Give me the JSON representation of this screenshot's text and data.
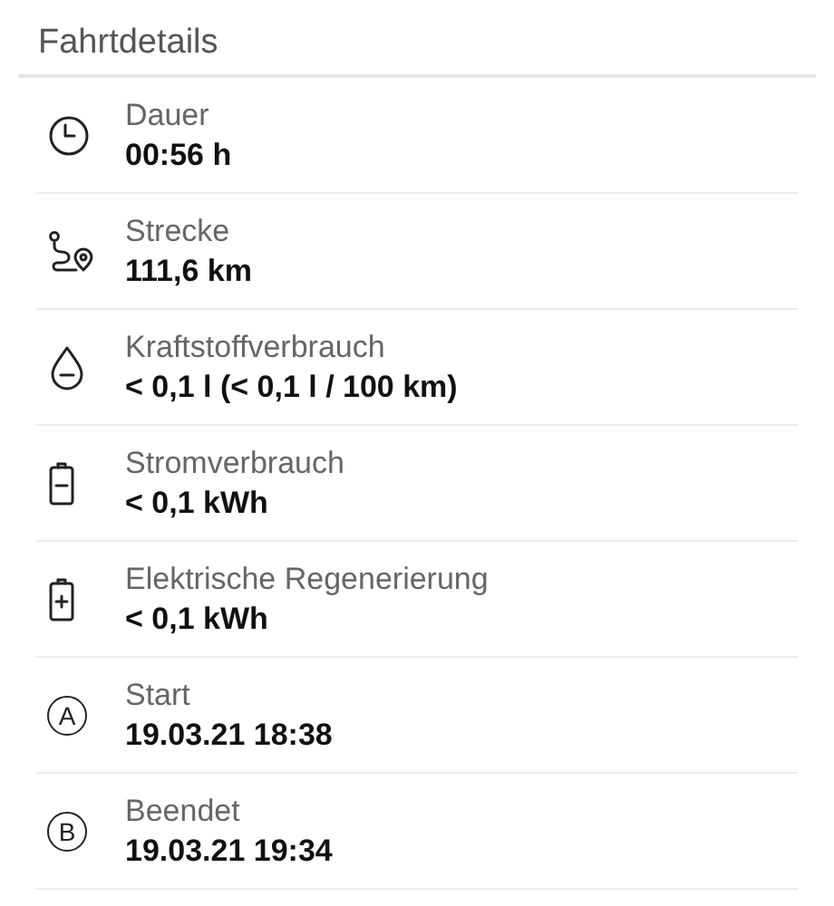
{
  "section": {
    "title": "Fahrtdetails"
  },
  "details": [
    {
      "kind": "clock",
      "label": "Dauer",
      "value": "00:56 h"
    },
    {
      "kind": "route",
      "label": "Strecke",
      "value": "111,6 km"
    },
    {
      "kind": "drop",
      "label": "Kraftstoffverbrauch",
      "value": "< 0,1 l (< 0,1 l / 100 km)"
    },
    {
      "kind": "battery-minus",
      "label": "Stromverbrauch",
      "value": "< 0,1 kWh"
    },
    {
      "kind": "battery-plus",
      "label": "Elektrische Regenerierung",
      "value": "< 0,1 kWh"
    },
    {
      "kind": "letter",
      "letter": "A",
      "label": "Start",
      "value": "19.03.21 18:38"
    },
    {
      "kind": "letter",
      "letter": "B",
      "label": "Beendet",
      "value": "19.03.21 19:34"
    }
  ]
}
